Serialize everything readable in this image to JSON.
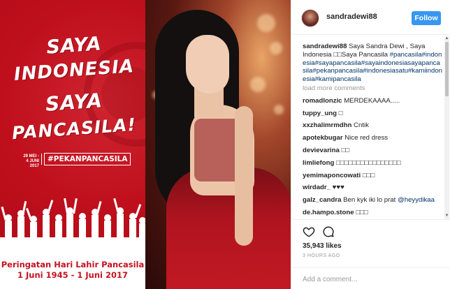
{
  "poster": {
    "slogan_line1": "SAYA",
    "slogan_line2": "INDONESIA",
    "slogan_line3": "SAYA",
    "slogan_line4": "PANCASILA!",
    "dates_text": "29 MEI - 4 JUNI 2017",
    "hashtag": "#PEKANPANCASILA",
    "footer_line1": "Peringatan Hari Lahir Pancasila",
    "footer_line2": "1 Juni 1945 - 1 Juni 2017"
  },
  "header": {
    "username": "sandradewi88",
    "follow_label": "Follow"
  },
  "caption": {
    "username": "sandradewi88",
    "text": "Saya Sandra Dewi , Saya Indonesia □□Saya Pancasila",
    "hashtags": "#pancasila#indonesia#sayapancasila#sayaindonesiasayapancasila#pekanpancasila#indonesiasatu#kamiindonesia#kamipancasila"
  },
  "load_more_label": "load more comments",
  "comments": [
    {
      "user": "romadlonzic",
      "text": "MERDEKAAAA....."
    },
    {
      "user": "tuppy_ung",
      "text": "□"
    },
    {
      "user": "xxzhalimrmdhn",
      "text": "Cntik"
    },
    {
      "user": "apotekbugar",
      "text": "Nice red dress"
    },
    {
      "user": "devievarina",
      "text": "□□"
    },
    {
      "user": "limliefong",
      "text": "□□□□□□□□□□□□□□□□"
    },
    {
      "user": "yemimaponcowati",
      "text": "□□□"
    },
    {
      "user": "wirdadr_",
      "text": "♥♥♥"
    },
    {
      "user": "galz_candra",
      "text": "Ben kyk iki lo prat ",
      "mention": "@heyydikaa"
    },
    {
      "user": "de.hampo.stone",
      "text": "□□□"
    }
  ],
  "actions": {
    "heart_icon": "heart-outline-icon",
    "comment_icon": "speech-bubble-icon",
    "likes_text": "35,943 likes",
    "time_text": "3 HOURS AGO",
    "add_comment_placeholder": "Add a comment..."
  },
  "colors": {
    "accent": "#3897f0",
    "poster_red": "#c5121f",
    "hashtag_link": "#003569"
  }
}
